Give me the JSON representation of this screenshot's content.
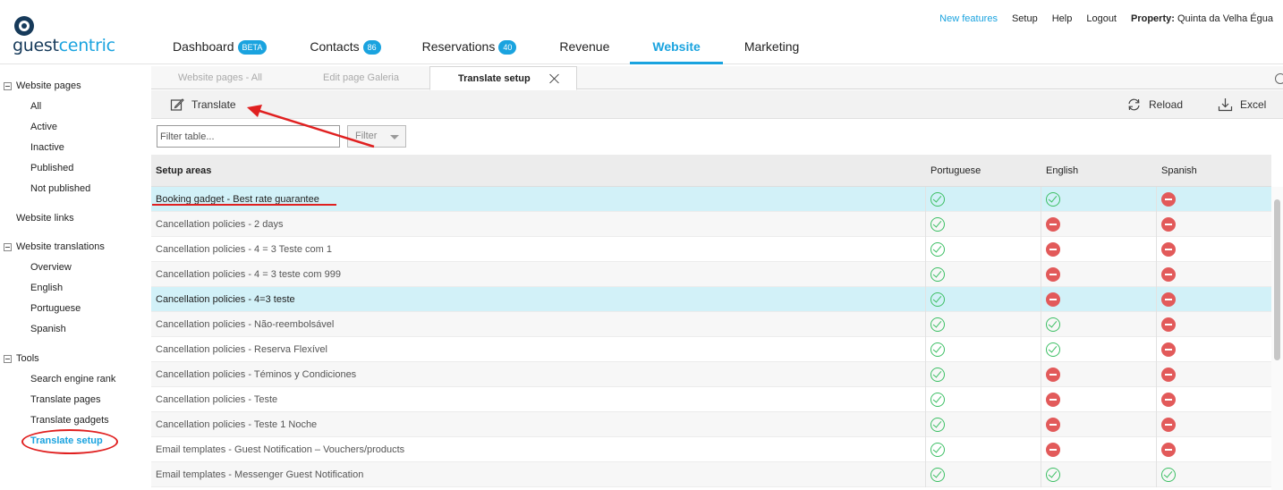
{
  "brand": {
    "guest": "guest",
    "centric": "centric"
  },
  "nav": {
    "items": [
      {
        "label": "Dashboard",
        "badge": "BETA"
      },
      {
        "label": "Contacts",
        "badge": "86"
      },
      {
        "label": "Reservations",
        "badge": "40"
      },
      {
        "label": "Revenue",
        "badge": ""
      },
      {
        "label": "Website",
        "badge": ""
      },
      {
        "label": "Marketing",
        "badge": ""
      }
    ],
    "active": "Website"
  },
  "topright": {
    "new_features": "New features",
    "setup": "Setup",
    "help": "Help",
    "logout": "Logout",
    "property_label": "Property:",
    "property_value": "Quinta da Velha Égua"
  },
  "sidebar": {
    "website_pages": "Website pages",
    "pages": [
      "All",
      "Active",
      "Inactive",
      "Published",
      "Not published"
    ],
    "website_links": "Website links",
    "website_translations": "Website translations",
    "translations": [
      "Overview",
      "English",
      "Portuguese",
      "Spanish"
    ],
    "tools": "Tools",
    "tool_items": [
      "Search engine rank",
      "Translate pages",
      "Translate gadgets",
      "Translate setup"
    ]
  },
  "tabs": [
    {
      "label": "Website pages - All"
    },
    {
      "label": "Edit page Galeria"
    },
    {
      "label": "Translate setup"
    }
  ],
  "toolbar": {
    "translate": "Translate",
    "reload": "Reload",
    "excel": "Excel"
  },
  "filter": {
    "placeholder": "Filter table...",
    "select": "Filter"
  },
  "table": {
    "headers": [
      "Setup areas",
      "Portuguese",
      "English",
      "Spanish"
    ],
    "rows": [
      {
        "name": "Booking gadget - Best rate guarantee",
        "pt": "ok",
        "en": "ok",
        "es": "no",
        "highlight": true
      },
      {
        "name": "Cancellation policies - 2 days",
        "pt": "ok",
        "en": "no",
        "es": "no",
        "highlight": false
      },
      {
        "name": "Cancellation policies - 4 = 3 Teste com 1",
        "pt": "ok",
        "en": "no",
        "es": "no",
        "highlight": false
      },
      {
        "name": "Cancellation policies - 4 = 3 teste com 999",
        "pt": "ok",
        "en": "no",
        "es": "no",
        "highlight": false
      },
      {
        "name": "Cancellation policies - 4=3 teste",
        "pt": "ok",
        "en": "no",
        "es": "no",
        "highlight": true
      },
      {
        "name": "Cancellation policies - Não-reembolsável",
        "pt": "ok",
        "en": "ok",
        "es": "no",
        "highlight": false
      },
      {
        "name": "Cancellation policies - Reserva Flexível",
        "pt": "ok",
        "en": "ok",
        "es": "no",
        "highlight": false
      },
      {
        "name": "Cancellation policies - Téminos y Condiciones",
        "pt": "ok",
        "en": "no",
        "es": "no",
        "highlight": false
      },
      {
        "name": "Cancellation policies - Teste",
        "pt": "ok",
        "en": "no",
        "es": "no",
        "highlight": false
      },
      {
        "name": "Cancellation policies - Teste 1 Noche",
        "pt": "ok",
        "en": "no",
        "es": "no",
        "highlight": false
      },
      {
        "name": "Email templates - Guest Notification – Vouchers/products",
        "pt": "ok",
        "en": "no",
        "es": "no",
        "highlight": false
      },
      {
        "name": "Email templates - Messenger Guest Notification",
        "pt": "ok",
        "en": "ok",
        "es": "ok",
        "highlight": false
      }
    ]
  },
  "colors": {
    "accent": "#1aa3df",
    "brand_dark": "#163a5a",
    "ok": "#3cbf64",
    "no": "#e25a5a",
    "highlight_row": "#d2f1f8",
    "annotation": "#e02020"
  }
}
